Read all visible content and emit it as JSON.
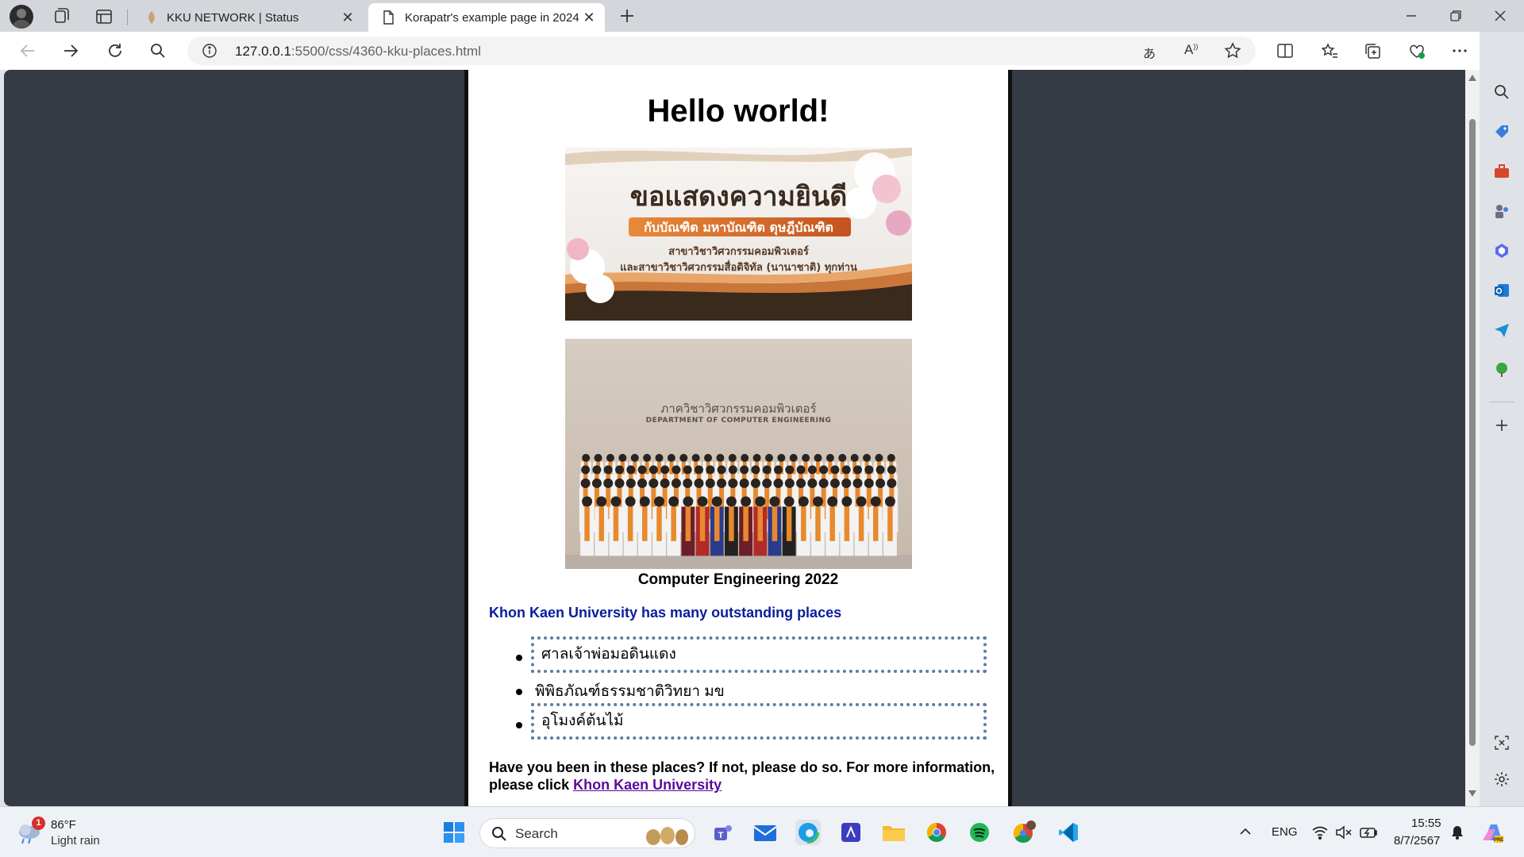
{
  "browser": {
    "tabs": [
      {
        "label": "KKU NETWORK | Status"
      },
      {
        "label": "Korapatr's example page in 2024"
      }
    ],
    "url_host": "127.0.0.1",
    "url_path": ":5500/css/4360-kku-places.html"
  },
  "page": {
    "heading": "Hello world!",
    "banner_title": "ขอแสดงความยินดี",
    "banner_subtitle": "กับบัณฑิต มหาบัณฑิต ดุษฎีบัณฑิต",
    "banner_line1": "สาขาวิชาวิศวกรรมคอมพิวเตอร์",
    "banner_line2": "และสาขาวิชาวิศวกรรมสื่อดิจิทัล (นานาชาติ) ทุกท่าน",
    "photo_sign_th": "ภาควิชาวิศวกรรมคอมพิวเตอร์",
    "photo_sign_en": "DEPARTMENT OF COMPUTER ENGINEERING",
    "caption": "Computer Engineering 2022",
    "intro": "Khon Kaen University has many outstanding places",
    "places": [
      {
        "name": "ศาลเจ้าพ่อมอดินแดง"
      },
      {
        "name": "พิพิธภัณฑ์ธรรมชาติวิทยา มข"
      },
      {
        "name": "อุโมงค์ต้นไม้"
      }
    ],
    "outro_text": "Have you been in these places? If not, please do so. For more information, please click ",
    "outro_link": "Khon Kaen University"
  },
  "taskbar": {
    "weather_temp": "86°F",
    "weather_desc": "Light rain",
    "weather_badge": "1",
    "search_placeholder": "Search",
    "language": "ENG",
    "time": "15:55",
    "date": "8/7/2567"
  }
}
